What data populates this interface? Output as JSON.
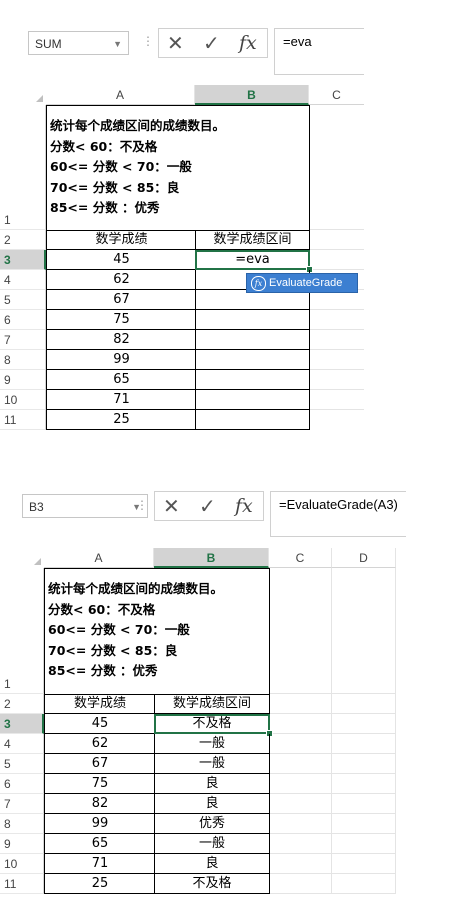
{
  "screenshot1": {
    "name_box": "SUM",
    "formula": "=eva",
    "columns": [
      "A",
      "B",
      "C"
    ],
    "selected_column": "B",
    "row_numbers": [
      "1",
      "2",
      "3",
      "4",
      "5",
      "6",
      "7",
      "8",
      "9",
      "10",
      "11"
    ],
    "selected_row": "3",
    "notes": [
      "统计每个成绩区间的成绩数目。",
      "分数< 60：不及格",
      "60<= 分数 < 70：一般",
      "70<= 分数 < 85：良",
      "85<= 分数 ：优秀"
    ],
    "headers": [
      "数学成绩",
      "数学成绩区间"
    ],
    "scores": [
      "45",
      "62",
      "67",
      "75",
      "82",
      "99",
      "65",
      "71",
      "25"
    ],
    "grades": [
      "=eva",
      "",
      "",
      "",
      "",
      "",
      "",
      "",
      ""
    ],
    "autocomplete": "EvaluateGrade"
  },
  "screenshot2": {
    "name_box": "B3",
    "formula": "=EvaluateGrade(A3)",
    "columns": [
      "A",
      "B",
      "C",
      "D"
    ],
    "selected_column": "B",
    "row_numbers": [
      "1",
      "2",
      "3",
      "4",
      "5",
      "6",
      "7",
      "8",
      "9",
      "10",
      "11"
    ],
    "selected_row": "3",
    "notes": [
      "统计每个成绩区间的成绩数目。",
      "分数< 60：不及格",
      "60<= 分数 < 70：一般",
      "70<= 分数 < 85：良",
      "85<= 分数 ：优秀"
    ],
    "headers": [
      "数学成绩",
      "数学成绩区间"
    ],
    "scores": [
      "45",
      "62",
      "67",
      "75",
      "82",
      "99",
      "65",
      "71",
      "25"
    ],
    "grades": [
      "不及格",
      "一般",
      "一般",
      "良",
      "良",
      "优秀",
      "一般",
      "良",
      "不及格"
    ]
  },
  "icons": {
    "name_box_dropdown": "chevron-down-icon",
    "cancel": "x-icon",
    "enter": "check-icon",
    "insert_function": "fx-icon",
    "autocomplete_item": "function-icon"
  },
  "colors": {
    "accent": "#217346",
    "header_selected_bg": "#d3d3d3",
    "autocomplete_bg": "#3c7fd1",
    "gridline": "#e4e4e4"
  }
}
